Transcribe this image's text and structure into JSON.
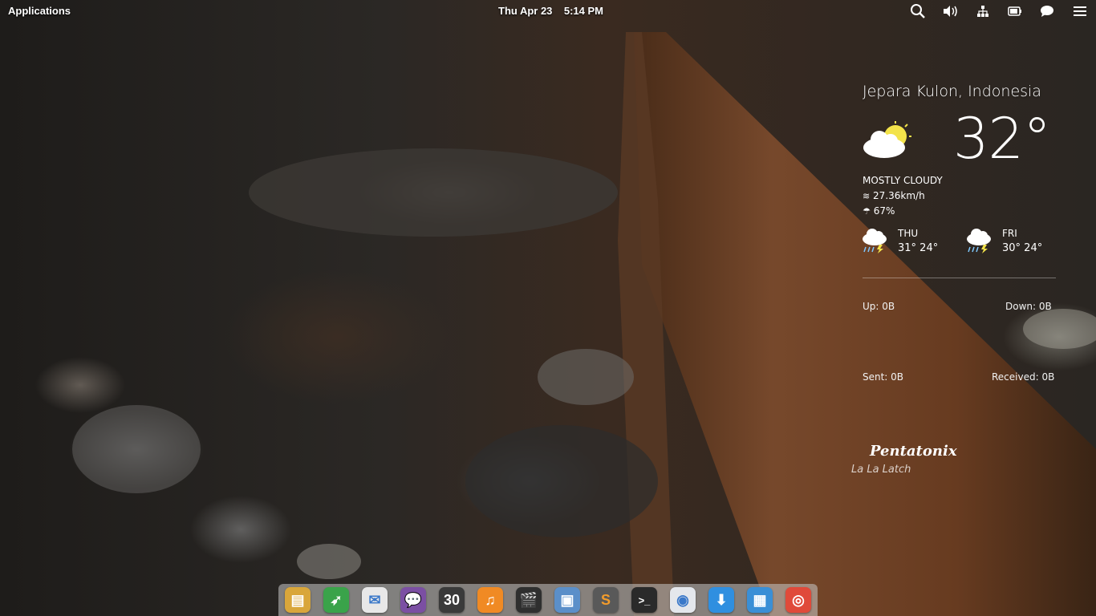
{
  "panel": {
    "applications_label": "Applications",
    "clock_text": "Thu Apr 23    5:14 PM"
  },
  "tray_icons": [
    "search-icon",
    "volume-icon",
    "network-icon",
    "battery-icon",
    "notifications-icon",
    "menu-icon"
  ],
  "weather": {
    "location": "Jepara Kulon, Indonesia",
    "temperature": "32°",
    "condition": "MOSTLY CLOUDY",
    "wind": "27.36km/h",
    "humidity": "67%",
    "forecast": [
      {
        "day": "THU",
        "range": "31° 24°",
        "icon": "thunderstorm-icon"
      },
      {
        "day": "FRI",
        "range": "30° 24°",
        "icon": "thunderstorm-icon"
      }
    ]
  },
  "network": {
    "up": "Up: 0B",
    "down": "Down: 0B",
    "sent": "Sent: 0B",
    "received": "Received: 0B"
  },
  "music": {
    "artist_logo": "Pentatonix",
    "song": "La La Latch"
  },
  "dock": {
    "items": [
      {
        "name": "files",
        "glyph": "▤",
        "color": "#d9a63a"
      },
      {
        "name": "browser",
        "glyph": "➶",
        "color": "#3aa34a"
      },
      {
        "name": "mail",
        "glyph": "✉",
        "color": "#e8e8e8"
      },
      {
        "name": "messaging",
        "glyph": "💬",
        "color": "#7b4fa3"
      },
      {
        "name": "calendar",
        "glyph": "30",
        "color": "#3a3a3a"
      },
      {
        "name": "music",
        "glyph": "♫",
        "color": "#f08a24"
      },
      {
        "name": "video",
        "glyph": "🎬",
        "color": "#2f2f2f"
      },
      {
        "name": "photos",
        "glyph": "▣",
        "color": "#5b8fc9"
      },
      {
        "name": "sublime",
        "glyph": "S",
        "color": "#595959"
      },
      {
        "name": "terminal",
        "glyph": ">_",
        "color": "#2a2a2a"
      },
      {
        "name": "settings",
        "glyph": "◉",
        "color": "#e4e7ec"
      },
      {
        "name": "downloader",
        "glyph": "⬇",
        "color": "#2f8fe0"
      },
      {
        "name": "workspaces",
        "glyph": "▦",
        "color": "#3a8fd6"
      },
      {
        "name": "chrome",
        "glyph": "◎",
        "color": "#e04a3a"
      }
    ]
  }
}
